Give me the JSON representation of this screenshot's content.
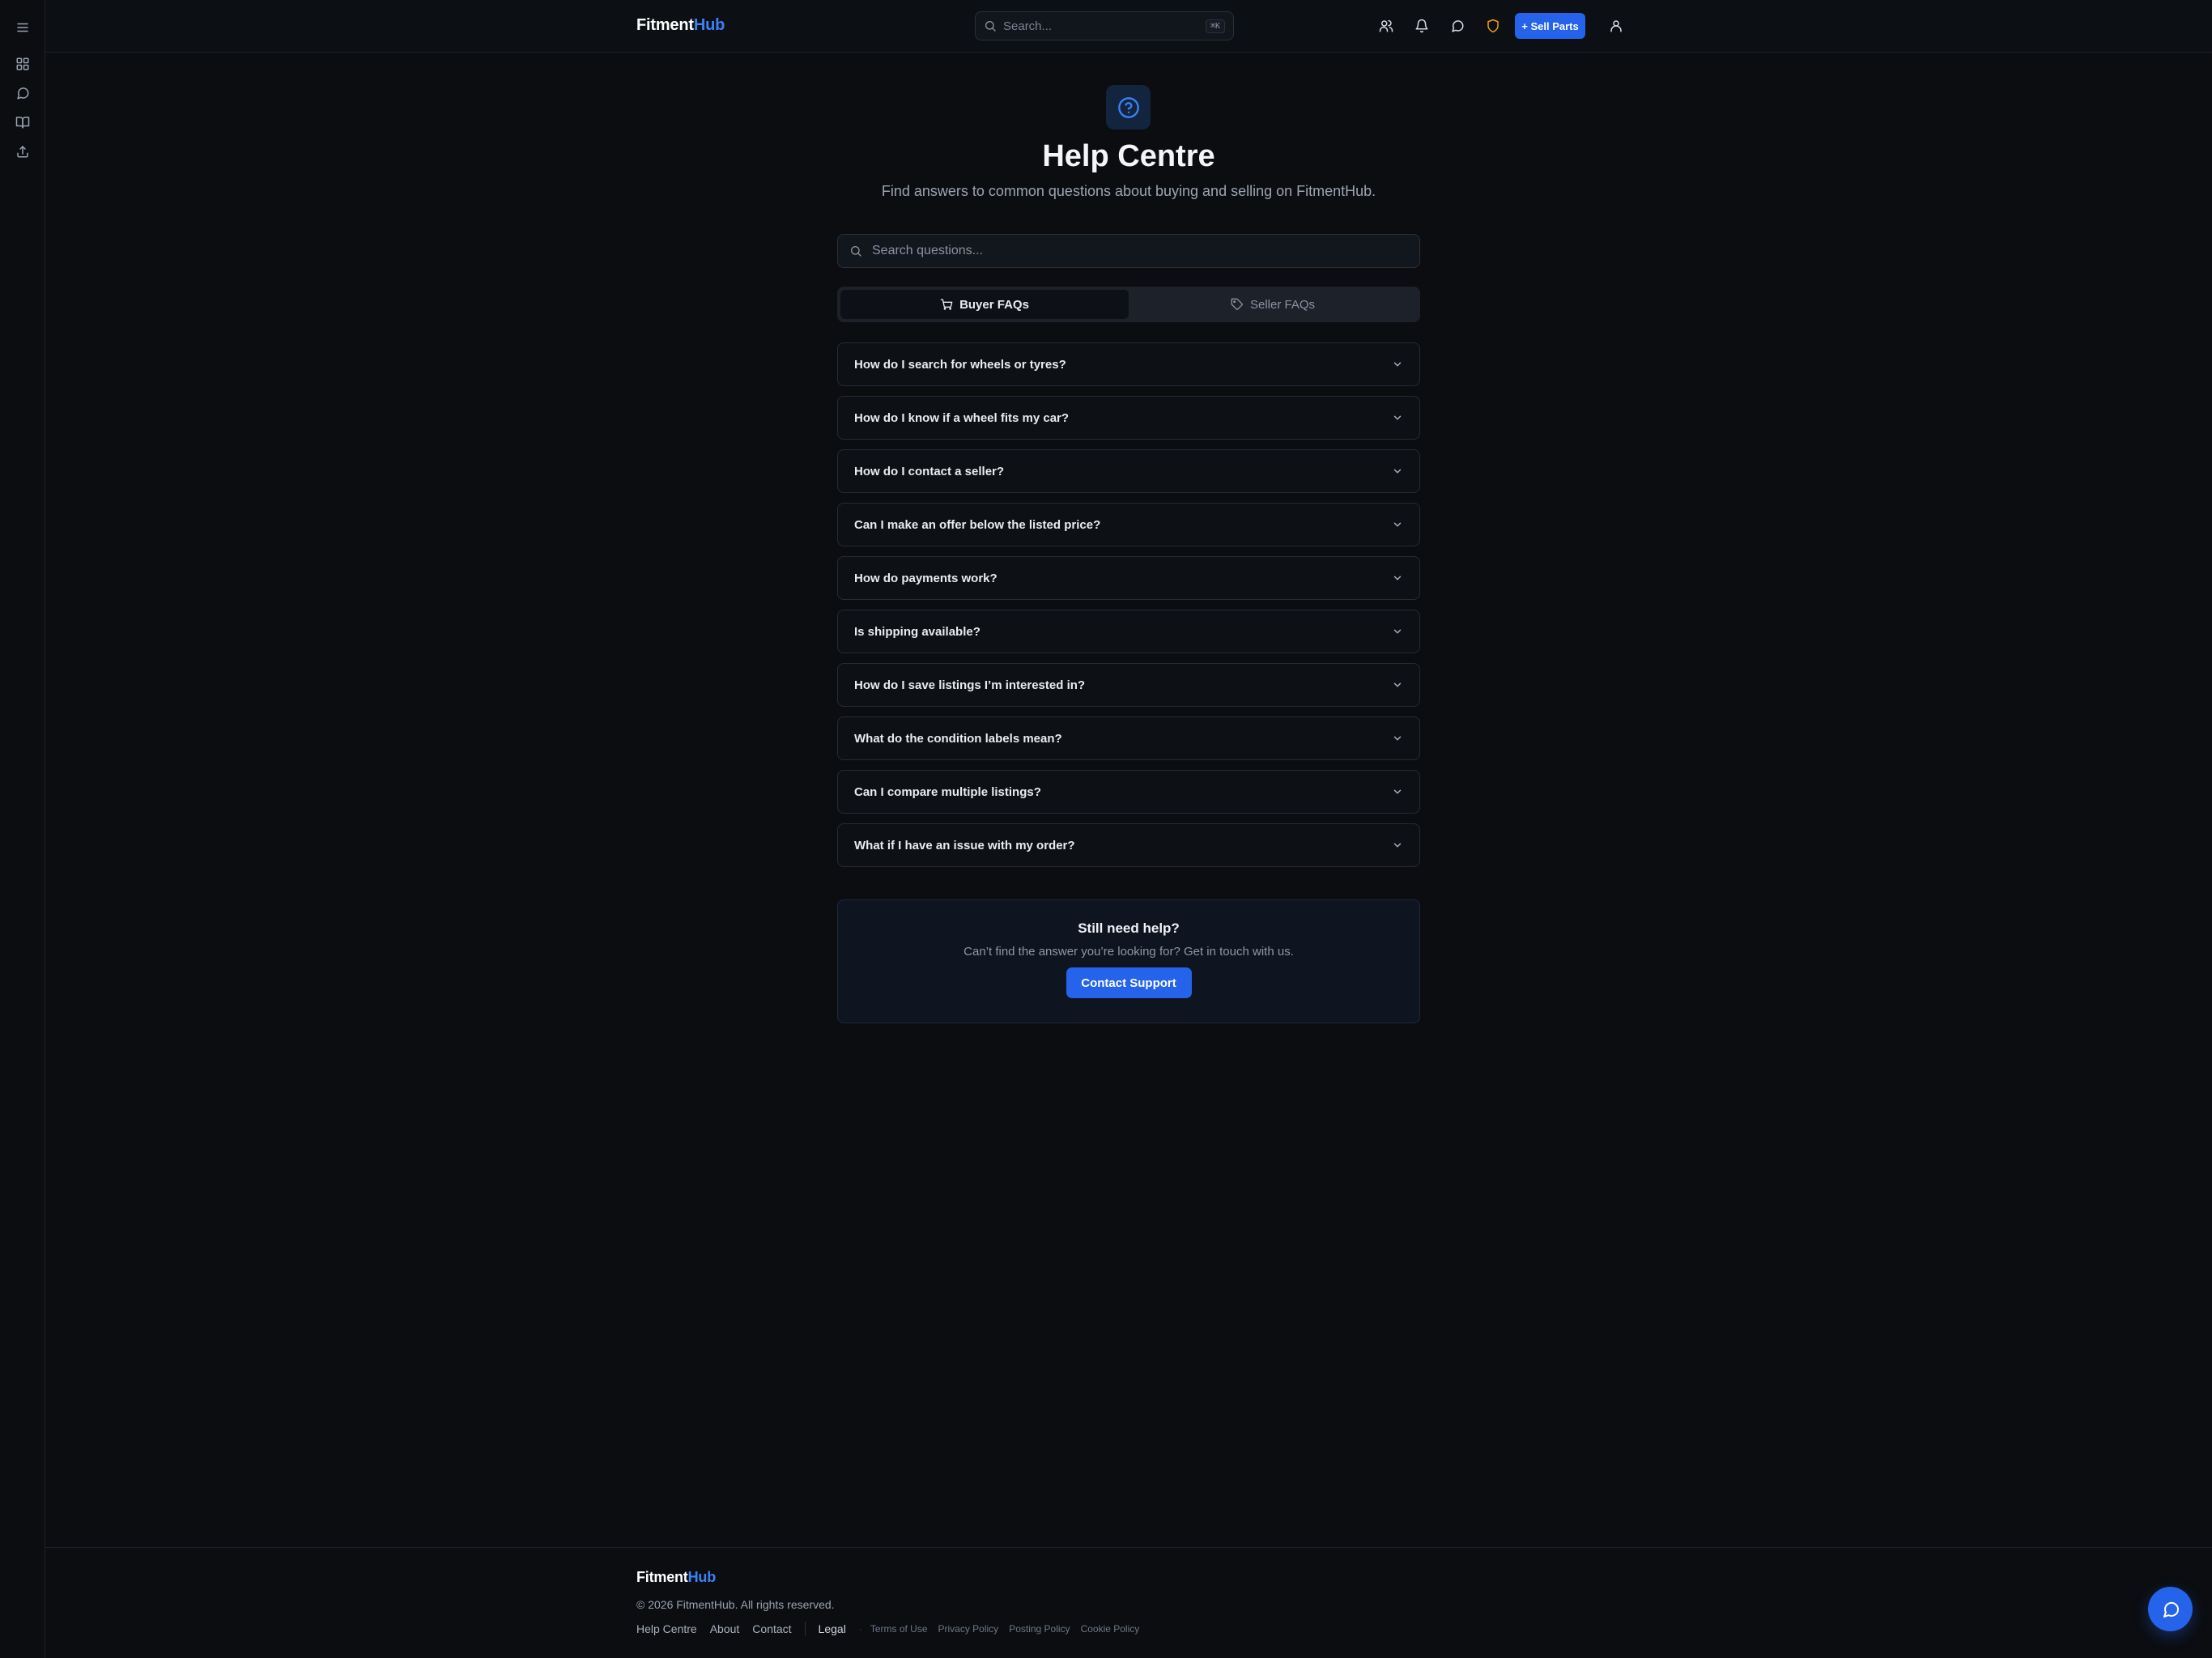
{
  "header": {
    "logo_main": "Fitment",
    "logo_accent": "Hub",
    "search_placeholder": "Search...",
    "search_shortcut": "⌘K",
    "sell_button": "+ Sell Parts",
    "icons": [
      "users-icon",
      "bell-icon",
      "message-icon",
      "shield-icon",
      "user-icon"
    ]
  },
  "rail": {
    "icons": [
      "menu-icon",
      "dashboard-icon",
      "chat-icon",
      "book-icon",
      "upload-icon"
    ]
  },
  "main": {
    "title": "Help Centre",
    "subtitle": "Find answers to common questions about buying and selling on FitmentHub.",
    "search_placeholder": "Search questions...",
    "tabs": [
      {
        "label": "Buyer FAQs",
        "active": true
      },
      {
        "label": "Seller FAQs",
        "active": false
      }
    ],
    "faqs": [
      "How do I search for wheels or tyres?",
      "How do I know if a wheel fits my car?",
      "How do I contact a seller?",
      "Can I make an offer below the listed price?",
      "How do payments work?",
      "Is shipping available?",
      "How do I save listings I’m interested in?",
      "What do the condition labels mean?",
      "Can I compare multiple listings?",
      "What if I have an issue with my order?"
    ]
  },
  "help_card": {
    "heading": "Still need help?",
    "text": "Can’t find the answer you’re looking for? Get in touch with us.",
    "button": "Contact Support"
  },
  "footer": {
    "logo_main": "Fitment",
    "logo_accent": "Hub",
    "copyright": "© 2026 FitmentHub. All rights reserved.",
    "links": [
      "Help Centre",
      "About",
      "Contact"
    ],
    "legal_label": "Legal",
    "legal_links": [
      "Terms of Use",
      "Privacy Policy",
      "Posting Policy",
      "Cookie Policy"
    ]
  },
  "colors": {
    "background": "#0b0d11",
    "accent": "#2563eb",
    "accent_text": "#3b82f6",
    "shield": "#f59e0b"
  }
}
